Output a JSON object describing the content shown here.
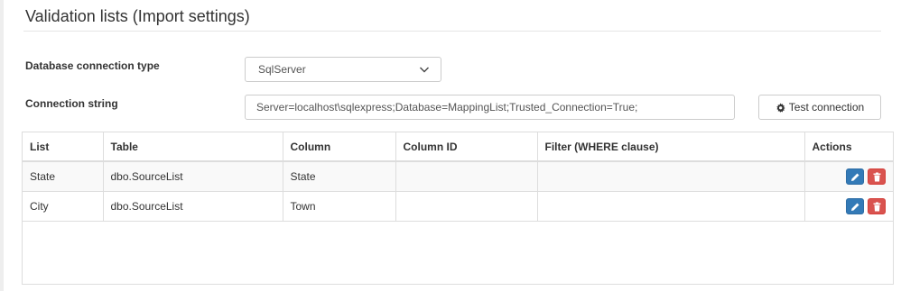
{
  "page": {
    "title": "Validation lists (Import settings)"
  },
  "form": {
    "db_type_label": "Database connection type",
    "db_type_value": "SqlServer",
    "conn_string_label": "Connection string",
    "conn_string_value": "Server=localhost\\sqlexpress;Database=MappingList;Trusted_Connection=True;",
    "test_button_label": "Test connection"
  },
  "table": {
    "headers": [
      "List",
      "Table",
      "Column",
      "Column ID",
      "Filter (WHERE clause)",
      "Actions"
    ],
    "rows": [
      {
        "list": "State",
        "table": "dbo.SourceList",
        "column": "State",
        "column_id": "",
        "filter": ""
      },
      {
        "list": "City",
        "table": "dbo.SourceList",
        "column": "Town",
        "column_id": "",
        "filter": ""
      }
    ]
  },
  "icons": {
    "select_chevron": "chevron-down-icon",
    "test_button": "gear-icon",
    "edit": "pencil-icon",
    "delete": "trash-icon"
  },
  "colors": {
    "edit_button": "#337ab7",
    "delete_button": "#d9534f",
    "zebra_row": "#f9f9f9"
  }
}
